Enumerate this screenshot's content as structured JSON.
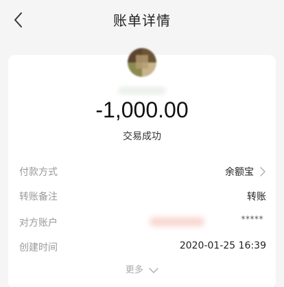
{
  "header": {
    "title": "账单详情",
    "back_icon": "chevron-left-icon"
  },
  "transaction": {
    "amount": "-1,000.00",
    "status": "交易成功"
  },
  "details": [
    {
      "label": "付款方式",
      "value": "余额宝",
      "has_chevron": true
    },
    {
      "label": "转账备注",
      "value": "转账"
    },
    {
      "label": "对方账户",
      "value": "*****"
    },
    {
      "label": "创建时间",
      "value": "2020-01-25 16:39"
    }
  ],
  "more": {
    "label": "更多",
    "icon": "chevron-down-icon"
  }
}
